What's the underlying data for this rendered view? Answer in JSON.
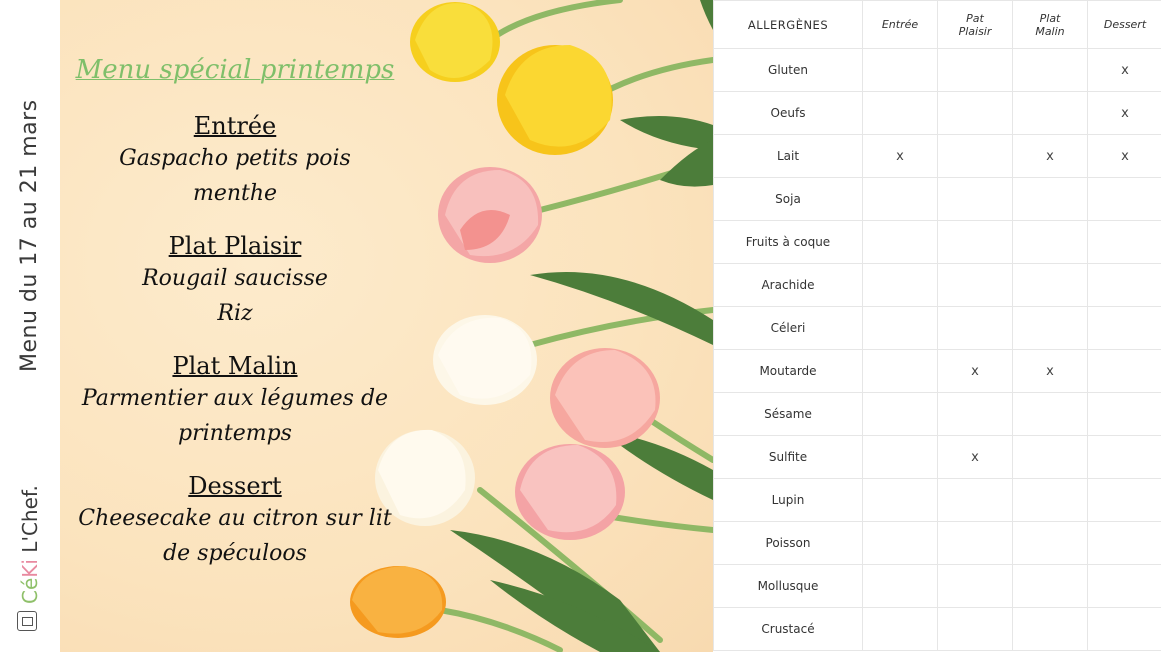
{
  "sidebar": {
    "period": "Menu du 17 au 21 mars",
    "brand_ce": "Cé",
    "brand_ki": "Ki",
    "brand_rest": " L'Chef."
  },
  "menu": {
    "title": "Menu spécial printemps",
    "courses": [
      {
        "heading": "Entrée",
        "lines": [
          "Gaspacho petits pois",
          "menthe"
        ]
      },
      {
        "heading": "Plat Plaisir",
        "lines": [
          "Rougail saucisse",
          "Riz"
        ]
      },
      {
        "heading": "Plat Malin",
        "lines": [
          "Parmentier aux légumes de",
          "printemps"
        ]
      },
      {
        "heading": "Dessert",
        "lines": [
          "Cheesecake au citron sur lit",
          "de spéculoos"
        ]
      }
    ]
  },
  "allergens": {
    "headers": [
      "ALLERGÈNES",
      "Entrée",
      "Pat Plaisir",
      "Plat Malin",
      "Dessert"
    ],
    "rows": [
      {
        "name": "Gluten",
        "marks": [
          "",
          "",
          "",
          "x"
        ]
      },
      {
        "name": "Oeufs",
        "marks": [
          "",
          "",
          "",
          "x"
        ]
      },
      {
        "name": "Lait",
        "marks": [
          "x",
          "",
          "x",
          "x"
        ]
      },
      {
        "name": "Soja",
        "marks": [
          "",
          "",
          "",
          ""
        ]
      },
      {
        "name": "Fruits à coque",
        "marks": [
          "",
          "",
          "",
          ""
        ]
      },
      {
        "name": "Arachide",
        "marks": [
          "",
          "",
          "",
          ""
        ]
      },
      {
        "name": "Céleri",
        "marks": [
          "",
          "",
          "",
          ""
        ]
      },
      {
        "name": "Moutarde",
        "marks": [
          "",
          "x",
          "x",
          ""
        ]
      },
      {
        "name": "Sésame",
        "marks": [
          "",
          "",
          "",
          ""
        ]
      },
      {
        "name": "Sulfite",
        "marks": [
          "",
          "x",
          "",
          ""
        ]
      },
      {
        "name": "Lupin",
        "marks": [
          "",
          "",
          "",
          ""
        ]
      },
      {
        "name": "Poisson",
        "marks": [
          "",
          "",
          "",
          ""
        ]
      },
      {
        "name": "Mollusque",
        "marks": [
          "",
          "",
          "",
          ""
        ]
      },
      {
        "name": "Crustacé",
        "marks": [
          "",
          "",
          "",
          ""
        ]
      }
    ]
  },
  "colors": {
    "title_green": "#7fbf6a",
    "panel_bg": "#fbe3bd"
  }
}
